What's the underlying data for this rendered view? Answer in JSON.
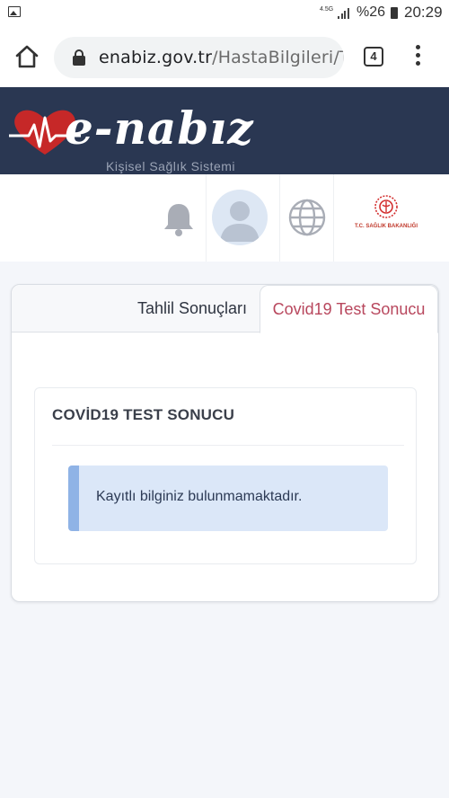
{
  "status_bar": {
    "network": "4.5G",
    "battery_percent": "%26",
    "time": "20:29"
  },
  "browser": {
    "url_host": "enabiz.gov.tr",
    "url_path": "/HastaBilgileri/Tal",
    "tab_count": "4"
  },
  "site": {
    "logo_text": "e-nabız",
    "logo_subtitle": "Kişisel Sağlık Sistemi",
    "ministry_label": "T.C. SAĞLIK BAKANLIĞI"
  },
  "tabs": [
    {
      "label": "Tahlil Sonuçları",
      "active": false
    },
    {
      "label": "Covid19 Test Sonucu",
      "active": true
    }
  ],
  "covid_panel": {
    "title": "COVİD19 TEST SONUCU",
    "message": "Kayıtlı bilginiz bulunmamaktadır."
  },
  "colors": {
    "header_bg": "#2a3752",
    "active_tab": "#b8475d",
    "alert_bg": "#dbe7f8",
    "alert_border": "#8fb3e6"
  }
}
